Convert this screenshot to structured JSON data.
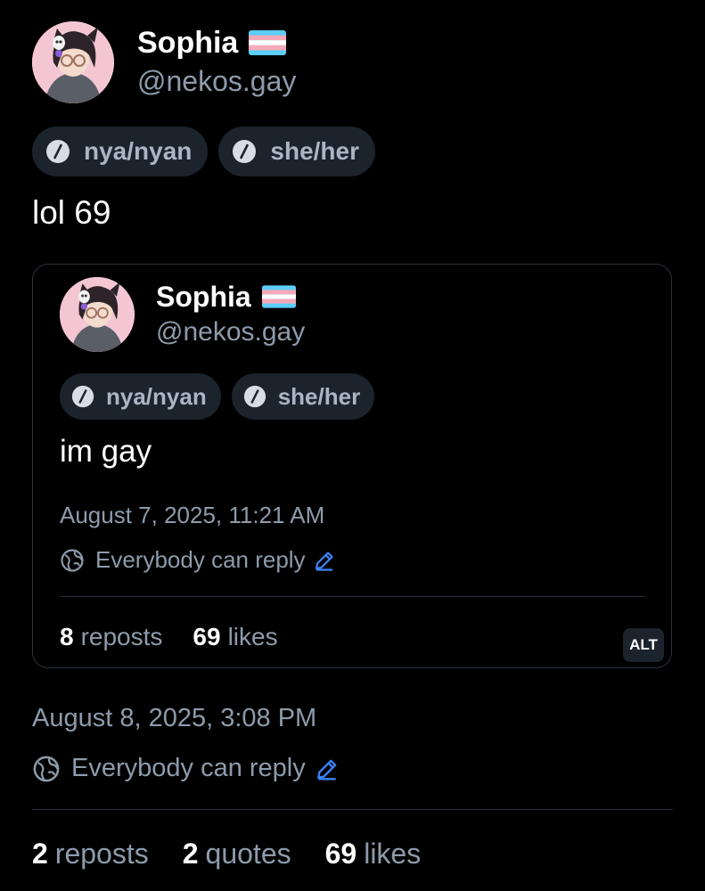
{
  "post": {
    "author": {
      "display_name": "Sophia",
      "handle": "@nekos.gay",
      "flag_icon": "trans-flag-icon"
    },
    "pronouns": [
      "nya/nyan",
      "she/her"
    ],
    "text": "lol 69",
    "timestamp": "August 8, 2025, 3:08 PM",
    "reply_setting": "Everybody can reply",
    "stats": {
      "reposts_count": "2",
      "reposts_label": "reposts",
      "quotes_count": "2",
      "quotes_label": "quotes",
      "likes_count": "69",
      "likes_label": "likes"
    }
  },
  "quoted_post": {
    "author": {
      "display_name": "Sophia",
      "handle": "@nekos.gay",
      "flag_icon": "trans-flag-icon"
    },
    "pronouns": [
      "nya/nyan",
      "she/her"
    ],
    "text": "im gay",
    "timestamp": "August 7, 2025, 11:21 AM",
    "reply_setting": "Everybody can reply",
    "stats": {
      "reposts_count": "8",
      "reposts_label": "reposts",
      "likes_count": "69",
      "likes_label": "likes"
    },
    "alt_badge": "ALT"
  },
  "colors": {
    "background": "#000000",
    "muted_text": "#8d9bab",
    "pill_bg": "#1b232d",
    "accent": "#3b82f6",
    "trans_blue": "#5bcefa",
    "trans_pink": "#f5a9b8"
  }
}
